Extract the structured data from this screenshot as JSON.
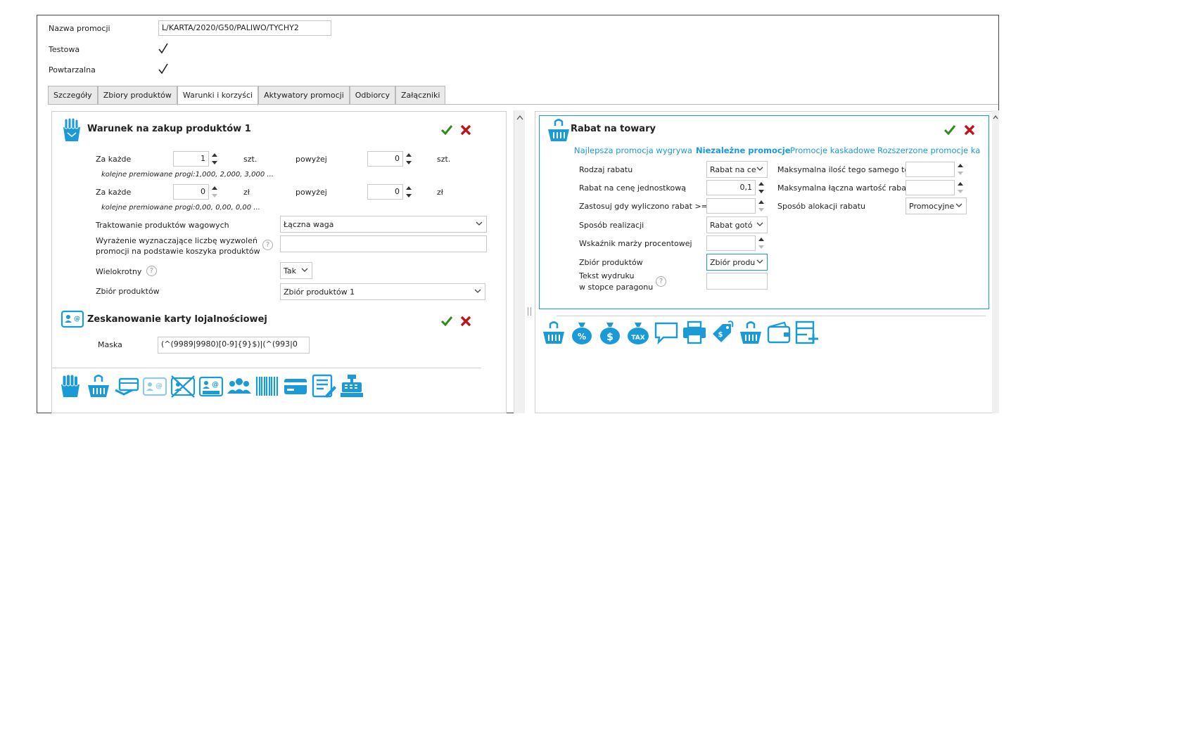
{
  "header": {
    "promo_name_label": "Nazwa promocji",
    "promo_name_value": "L/KARTA/2020/G50/PALIWO/TYCHY2",
    "test_label": "Testowa",
    "repeat_label": "Powtarzalna"
  },
  "tabs": [
    {
      "label": "Szczegóły"
    },
    {
      "label": "Zbiory produktów"
    },
    {
      "label": "Warunki i korzyści"
    },
    {
      "label": "Aktywatory promocji"
    },
    {
      "label": "Odbiorcy"
    },
    {
      "label": "Załączniki"
    }
  ],
  "condition": {
    "title": "Warunek na zakup produktów 1",
    "row1_label": "Za każde",
    "row1_value": "1",
    "row1_unit": "szt.",
    "row1_above_label": "powyżej",
    "row1_above_value": "0",
    "row1_above_unit": "szt.",
    "row1_hint": "kolejne premiowane progi:1,000, 2,000, 3,000 ...",
    "row2_label": "Za każde",
    "row2_value": "0",
    "row2_unit": "zł",
    "row2_above_label": "powyżej",
    "row2_above_value": "0",
    "row2_above_unit": "zł",
    "row2_hint": "kolejne premiowane progi:0,00, 0,00, 0,00 ...",
    "weight_label": "Traktowanie produktów wagowych",
    "weight_value": "Łączna waga",
    "expr_label_1": "Wyrażenie wyznaczające liczbę wyzwoleń",
    "expr_label_2": "promocji na podstawie koszyka produktów",
    "expr_value": "",
    "multi_label": "Wielokrotny",
    "multi_value": "Tak",
    "set_label": "Zbiór produktów",
    "set_value": "Zbiór produktów 1"
  },
  "loyalty": {
    "title": "Zeskanowanie karty lojalnościowej",
    "mask_label": "Maska",
    "mask_value": "(^(9989|9980)[0-9]{9}$)|(^(993|0"
  },
  "discount": {
    "title": "Rabat na towary",
    "modes": [
      {
        "label": "Najlepsza promocja wygrywa",
        "selected": false
      },
      {
        "label": "Niezależne promocje",
        "selected": true
      },
      {
        "label": "Promocje kaskadowe",
        "selected": false
      },
      {
        "label": "Rozszerzone promocje ka",
        "selected": false
      }
    ],
    "type_label": "Rodzaj rabatu",
    "type_value": "Rabat na ce",
    "unit_price_label": "Rabat na cenę jednostkową",
    "unit_price_value": "0,1",
    "apply_label": "Zastosuj gdy wyliczono rabat >=",
    "apply_value": "",
    "realization_label": "Sposób realizacji",
    "realization_value": "Rabat gotó",
    "margin_label": "Wskaźnik marży procentowej",
    "margin_value": "",
    "set_label": "Zbiór produktów",
    "set_value": "Zbiór produ",
    "print_label_1": "Tekst wydruku",
    "print_label_2": "w stopce paragonu",
    "print_value": "",
    "max_qty_label": "Maksymalna ilość tego samego to",
    "max_qty_value": "",
    "max_total_label": "Maksymalna łączna wartość rabat",
    "max_total_value": "",
    "alloc_label": "Sposób alokacji rabatu",
    "alloc_value": "Promocyjne"
  },
  "colors": {
    "accent": "#1a9bd7",
    "ok": "#2e8b1e",
    "cancel": "#c0141b"
  }
}
